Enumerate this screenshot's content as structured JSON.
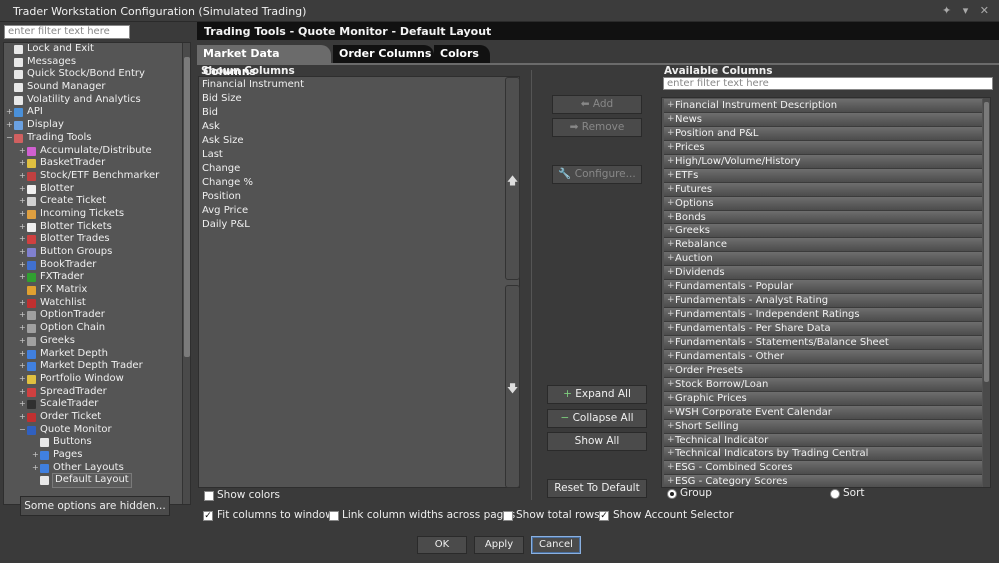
{
  "window": {
    "title": "Trader Workstation Configuration (Simulated Trading)",
    "controls": "✦ ▾ ✕"
  },
  "left": {
    "filter_placeholder": "enter filter text here",
    "tree": [
      {
        "label": "Lock and Exit",
        "icon": "page-icon",
        "color": "#e8e8e8",
        "depth": 0,
        "exp": ""
      },
      {
        "label": "Messages",
        "icon": "page-icon",
        "color": "#e8e8e8",
        "depth": 0,
        "exp": ""
      },
      {
        "label": "Quick Stock/Bond Entry",
        "icon": "page-icon",
        "color": "#e8e8e8",
        "depth": 0,
        "exp": ""
      },
      {
        "label": "Sound Manager",
        "icon": "page-icon",
        "color": "#e8e8e8",
        "depth": 0,
        "exp": ""
      },
      {
        "label": "Volatility and Analytics",
        "icon": "page-icon",
        "color": "#e8e8e8",
        "depth": 0,
        "exp": ""
      },
      {
        "label": "API",
        "icon": "api-icon",
        "color": "#4a90d9",
        "depth": 0,
        "exp": "+"
      },
      {
        "label": "Display",
        "icon": "display-icon",
        "color": "#6aa0e0",
        "depth": 0,
        "exp": "+"
      },
      {
        "label": "Trading Tools",
        "icon": "tools-icon",
        "color": "#d06060",
        "depth": 0,
        "exp": "−"
      },
      {
        "label": "Accumulate/Distribute",
        "icon": "accumulate-icon",
        "color": "#d060d0",
        "depth": 1,
        "exp": "+"
      },
      {
        "label": "BasketTrader",
        "icon": "basket-icon",
        "color": "#e0c040",
        "depth": 1,
        "exp": "+"
      },
      {
        "label": "Stock/ETF Benchmarker",
        "icon": "benchmark-icon",
        "color": "#c04040",
        "depth": 1,
        "exp": "+"
      },
      {
        "label": "Blotter",
        "icon": "blotter-icon",
        "color": "#f0f0f0",
        "depth": 1,
        "exp": "+"
      },
      {
        "label": "Create Ticket",
        "icon": "ticket-icon",
        "color": "#d0d0d0",
        "depth": 1,
        "exp": "+"
      },
      {
        "label": "Incoming Tickets",
        "icon": "incoming-icon",
        "color": "#e0a040",
        "depth": 1,
        "exp": "+"
      },
      {
        "label": "Blotter Tickets",
        "icon": "blotter-ticket-icon",
        "color": "#f0f0f0",
        "depth": 1,
        "exp": "+"
      },
      {
        "label": "Blotter Trades",
        "icon": "trades-icon",
        "color": "#d04040",
        "depth": 1,
        "exp": "+"
      },
      {
        "label": "Button Groups",
        "icon": "button-groups-icon",
        "color": "#8080d0",
        "depth": 1,
        "exp": "+"
      },
      {
        "label": "BookTrader",
        "icon": "book-icon",
        "color": "#4070d0",
        "depth": 1,
        "exp": "+"
      },
      {
        "label": "FXTrader",
        "icon": "fx-icon",
        "color": "#30a030",
        "depth": 1,
        "exp": "+"
      },
      {
        "label": "FX Matrix",
        "icon": "fx-matrix-icon",
        "color": "#e0a030",
        "depth": 1,
        "exp": ""
      },
      {
        "label": "Watchlist",
        "icon": "watchlist-icon",
        "color": "#c03030",
        "depth": 1,
        "exp": "+"
      },
      {
        "label": "OptionTrader",
        "icon": "option-icon",
        "color": "#a0a0a0",
        "depth": 1,
        "exp": "+"
      },
      {
        "label": "Option Chain",
        "icon": "chain-icon",
        "color": "#a0a0a0",
        "depth": 1,
        "exp": "+"
      },
      {
        "label": "Greeks",
        "icon": "greeks-icon",
        "color": "#a0a0a0",
        "depth": 1,
        "exp": "+"
      },
      {
        "label": "Market Depth",
        "icon": "depth-icon",
        "color": "#4080e0",
        "depth": 1,
        "exp": "+"
      },
      {
        "label": "Market Depth Trader",
        "icon": "depth-trader-icon",
        "color": "#4080e0",
        "depth": 1,
        "exp": "+"
      },
      {
        "label": "Portfolio Window",
        "icon": "portfolio-icon",
        "color": "#e0c040",
        "depth": 1,
        "exp": "+"
      },
      {
        "label": "SpreadTrader",
        "icon": "spread-icon",
        "color": "#d04040",
        "depth": 1,
        "exp": "+"
      },
      {
        "label": "ScaleTrader",
        "icon": "scale-icon",
        "color": "#303030",
        "depth": 1,
        "exp": "+"
      },
      {
        "label": "Order Ticket",
        "icon": "order-ticket-icon",
        "color": "#c03030",
        "depth": 1,
        "exp": "+"
      },
      {
        "label": "Quote Monitor",
        "icon": "quote-monitor-icon",
        "color": "#3060c0",
        "depth": 1,
        "exp": "−"
      },
      {
        "label": "Buttons",
        "icon": "page-icon",
        "color": "#e8e8e8",
        "depth": 2,
        "exp": ""
      },
      {
        "label": "Pages",
        "icon": "pages-icon",
        "color": "#4080e0",
        "depth": 2,
        "exp": "+"
      },
      {
        "label": "Other Layouts",
        "icon": "layouts-icon",
        "color": "#4080e0",
        "depth": 2,
        "exp": "+"
      },
      {
        "label": "Default Layout",
        "icon": "page-icon",
        "color": "#e8e8e8",
        "depth": 2,
        "exp": "",
        "selected": true
      }
    ],
    "hidden_button": "Some options are hidden..."
  },
  "header": {
    "title": "Trading Tools - Quote Monitor - Default Layout"
  },
  "tabs": [
    {
      "label": "Market Data Columns",
      "active": true
    },
    {
      "label": "Order Columns",
      "active": false
    },
    {
      "label": "Colors",
      "active": false
    }
  ],
  "shown": {
    "label": "Shown Columns",
    "items": [
      "Financial Instrument",
      "Bid Size",
      "Bid",
      "Ask",
      "Ask Size",
      "Last",
      "Change",
      "Change %",
      "Position",
      "Avg Price",
      "Daily P&L"
    ]
  },
  "middle": {
    "add": "Add",
    "remove": "Remove",
    "configure": "Configure...",
    "expand_all": "Expand All",
    "collapse_all": "Collapse All",
    "show_all": "Show All",
    "reset": "Reset To Default"
  },
  "available": {
    "label": "Available Columns",
    "filter_placeholder": "enter filter text here",
    "items": [
      "Financial Instrument Description",
      "News",
      "Position and P&L",
      "Prices",
      "High/Low/Volume/History",
      "ETFs",
      "Futures",
      "Options",
      "Bonds",
      "Greeks",
      "Rebalance",
      "Auction",
      "Dividends",
      "Fundamentals - Popular",
      "Fundamentals - Analyst Rating",
      "Fundamentals - Independent Ratings",
      "Fundamentals - Per Share Data",
      "Fundamentals - Statements/Balance Sheet",
      "Fundamentals - Other",
      "Order Presets",
      "Stock Borrow/Loan",
      "Graphic Prices",
      "WSH Corporate Event Calendar",
      "Short Selling",
      "Technical Indicator",
      "Technical Indicators by Trading Central",
      "ESG - Combined Scores",
      "ESG - Category Scores"
    ],
    "group_label": "Group",
    "sort_label": "Sort"
  },
  "options": {
    "show_colors": "Show colors",
    "fit_columns": "Fit columns to window",
    "link_widths": "Link column widths across pages",
    "show_total_rows": "Show total rows",
    "show_account_selector": "Show Account Selector"
  },
  "footer": {
    "ok": "OK",
    "apply": "Apply",
    "cancel": "Cancel"
  }
}
